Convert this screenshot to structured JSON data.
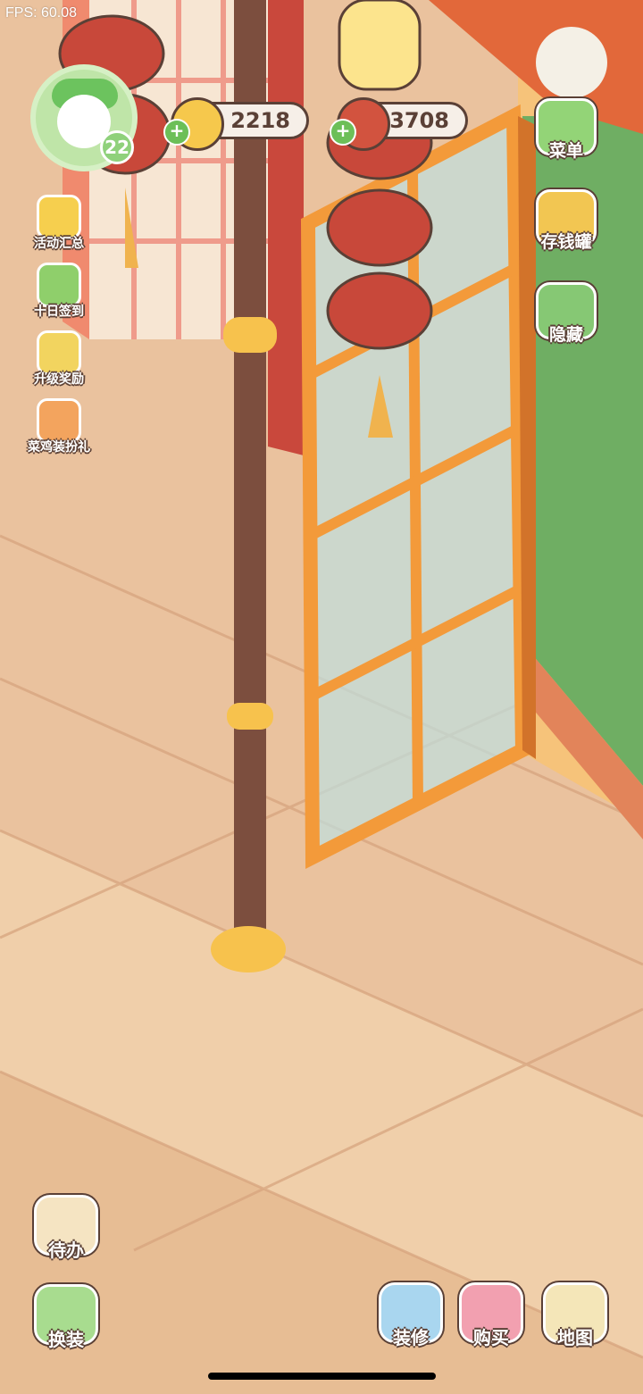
{
  "status": {
    "fps": "FPS: 60.08"
  },
  "player": {
    "level": "22"
  },
  "currencies": {
    "coins": {
      "value": "2218",
      "icon": "gold-coin-icon"
    },
    "tomatoes": {
      "value": "3708",
      "icon": "tomato-icon"
    }
  },
  "left_menu": [
    {
      "label": "活动汇总",
      "icon": "event-summary-icon"
    },
    {
      "label": "十日签到",
      "icon": "ten-day-checkin-icon"
    },
    {
      "label": "升级奖励",
      "icon": "level-reward-icon"
    },
    {
      "label": "菜鸡装扮礼",
      "icon": "dressup-gift-icon"
    }
  ],
  "right_menu": [
    {
      "label": "菜单",
      "icon": "menu-list-icon"
    },
    {
      "label": "存钱罐",
      "icon": "piggy-bank-icon"
    },
    {
      "label": "隐藏",
      "icon": "hide-ui-icon"
    }
  ],
  "bottom_left": [
    {
      "label": "待办",
      "icon": "todo-list-icon"
    },
    {
      "label": "换装",
      "icon": "change-outfit-icon"
    }
  ],
  "bottom_right": [
    {
      "label": "装修",
      "icon": "decorate-icon"
    },
    {
      "label": "购买",
      "icon": "shop-icon"
    },
    {
      "label": "地图",
      "icon": "map-icon"
    }
  ],
  "colors": {
    "floor": "#eac29e",
    "outline": "#5a4036",
    "door_frame": "#f39a3a",
    "lantern": "#c8483a",
    "hedge": "#6fae63"
  }
}
